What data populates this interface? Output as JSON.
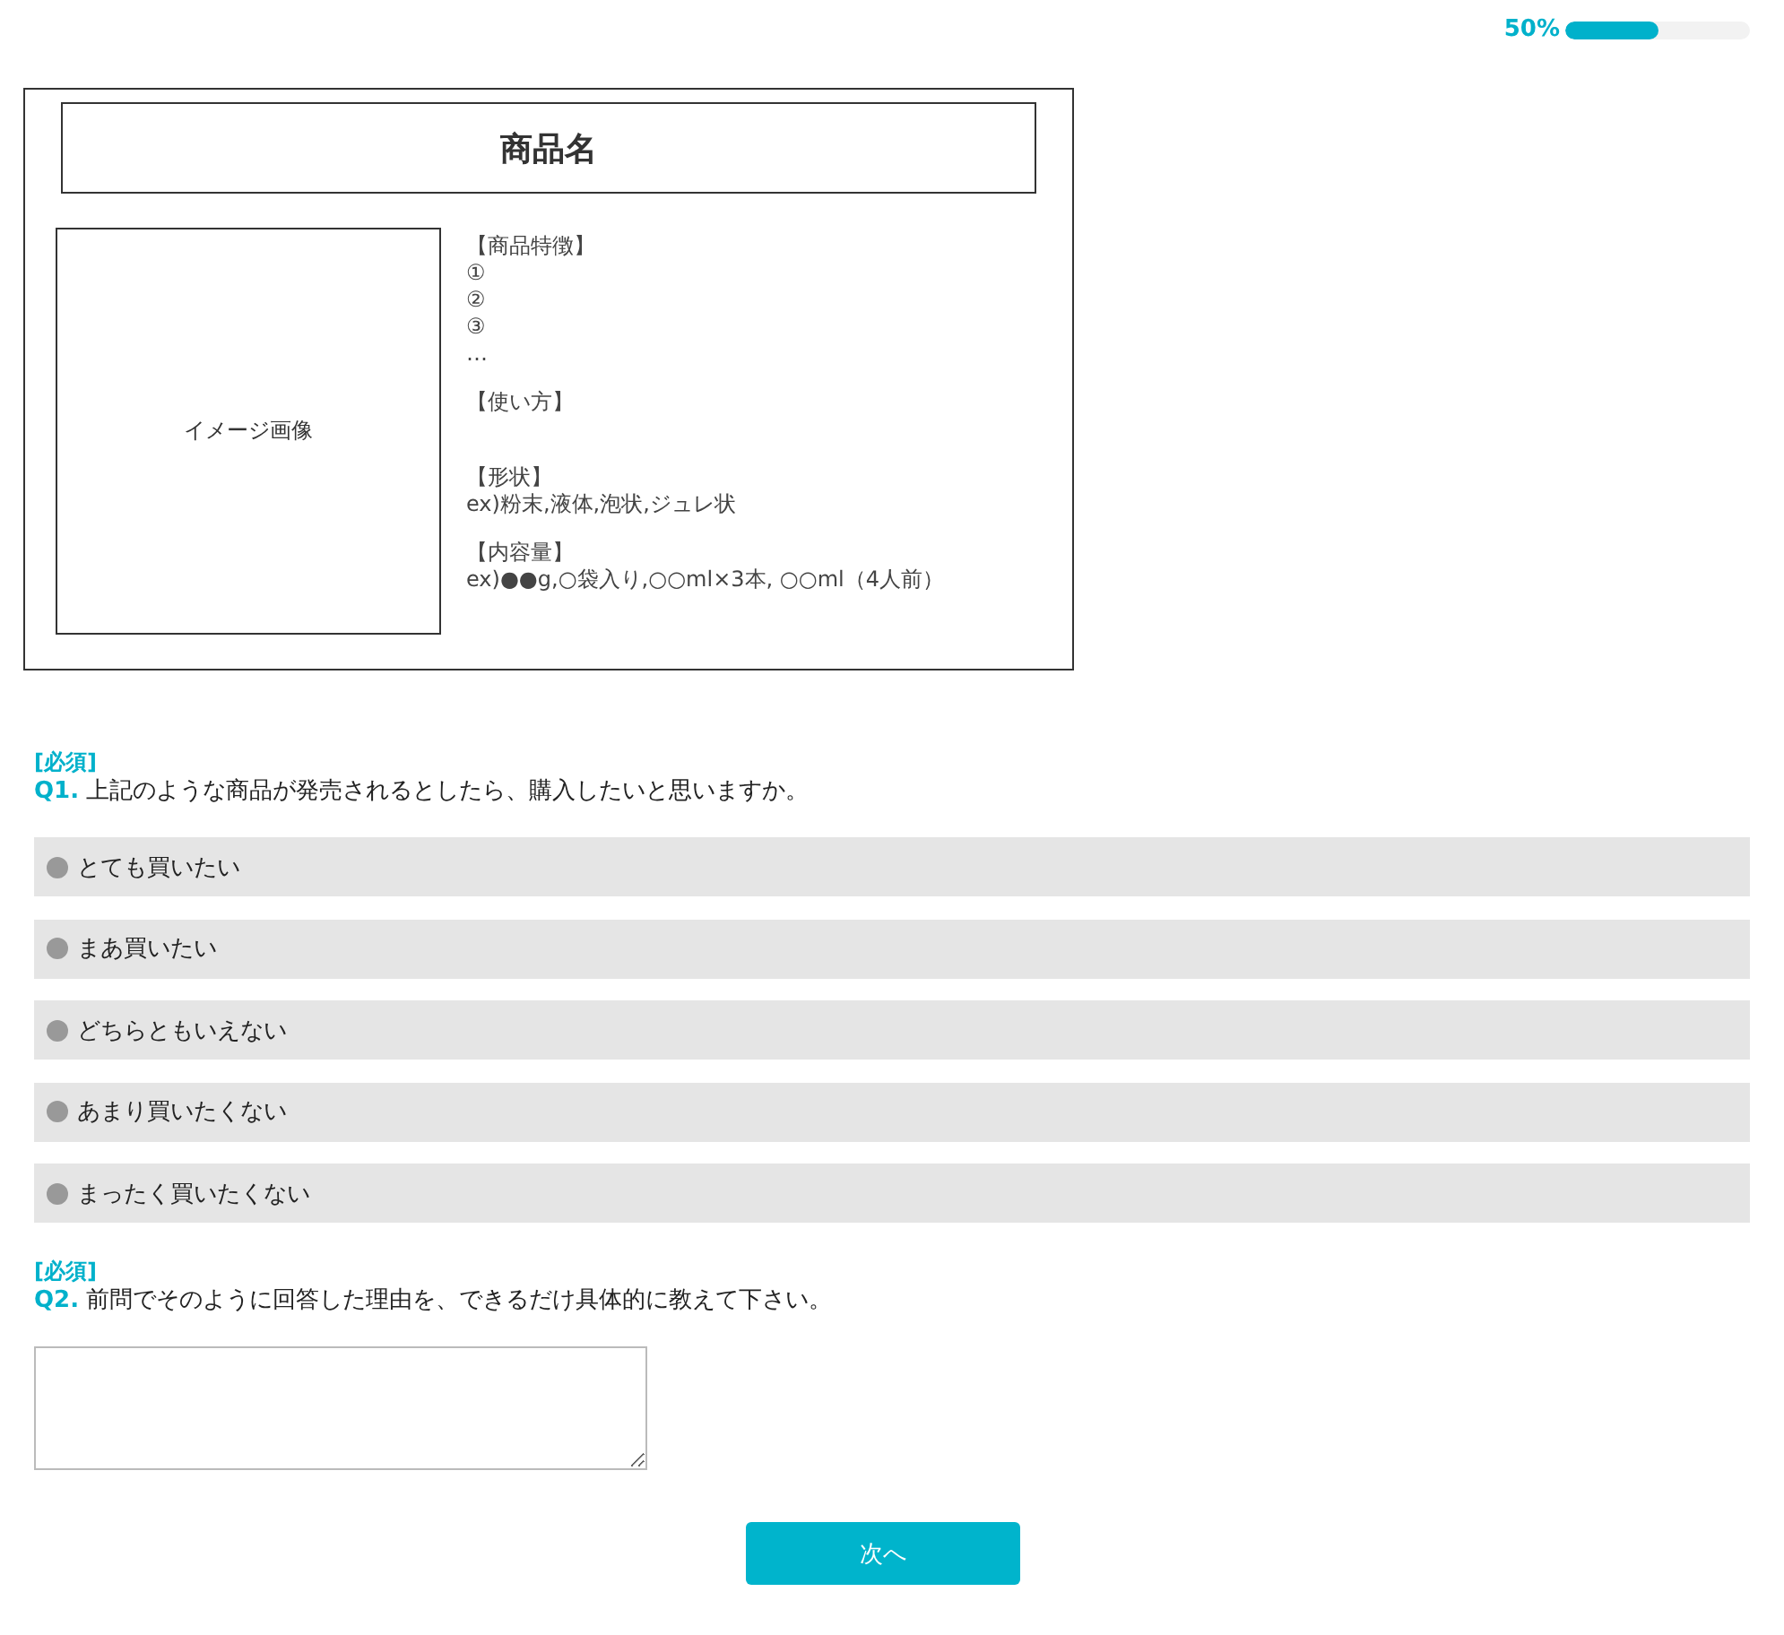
{
  "progress": {
    "label": "50%",
    "level": 0.5
  },
  "product": {
    "title": "商品名",
    "image_label": "イメージ画像",
    "sections": [
      {
        "heading": "【商品特徴】",
        "lines": [
          "①",
          "②",
          "③",
          "…"
        ]
      },
      {
        "heading": "【使い方】"
      },
      {
        "heading": "【形状】",
        "lines": [
          "ex)粉末,液体,泡状,ジュレ状"
        ]
      },
      {
        "heading": "【内容量】",
        "lines": [
          "ex)●●g,○袋入り,○○ml×3本, ○○ml（4人前）"
        ]
      }
    ]
  },
  "questions": [
    {
      "required": "[必須]",
      "number": "Q1.",
      "text": "上記のような商品が発売されるとしたら、購入したいと思いますか。",
      "kind": "radio",
      "options": [
        {
          "label": "とても買いたい",
          "selected": false
        },
        {
          "label": "まあ買いたい",
          "selected": false
        },
        {
          "label": "どちらともいえない",
          "selected": false
        },
        {
          "label": "あまり買いたくない",
          "selected": false
        },
        {
          "label": "まったく買いたくない",
          "selected": false
        }
      ]
    },
    {
      "required": "[必須]",
      "number": "Q2.",
      "text": "前問でそのように回答した理由を、できるだけ具体的に教えて下さい。",
      "kind": "textarea"
    }
  ],
  "next_button": "次へ"
}
